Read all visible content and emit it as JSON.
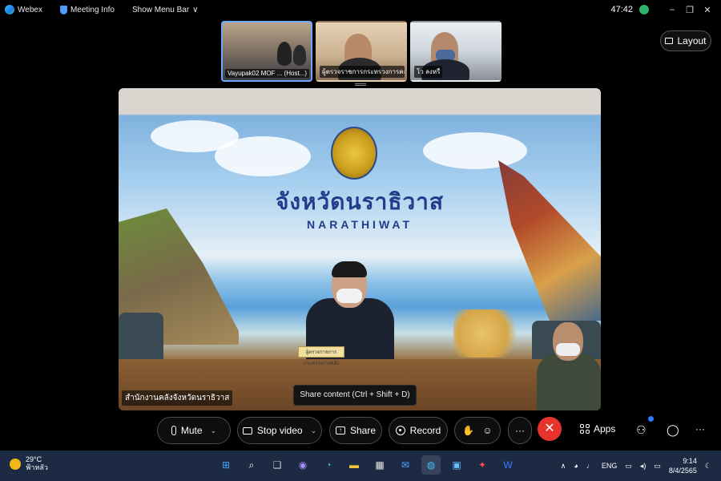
{
  "topbar": {
    "app_name": "Webex",
    "meeting_info": "Meeting Info",
    "show_menu_bar": "Show Menu Bar",
    "chevron": "∨",
    "timer": "47:42",
    "minimize": "–",
    "restore": "❐",
    "close": "✕"
  },
  "thumbnails": [
    {
      "label": "Vayupak02 MOF ... (Host...)"
    },
    {
      "label": "ผู้ตรวจราชการกระทรวงการคลัง"
    },
    {
      "label": "โว ลงหรื"
    }
  ],
  "layout_button": {
    "label": "Layout"
  },
  "main_video": {
    "title_th": "จังหวัดนราธิวาส",
    "title_en": "NARATHIWAT",
    "caption": "สำนักงานคลังจังหวัดนราธิวาส",
    "nameplate": "ผู้ตรวจราชการกระทรวงการคลัง"
  },
  "tooltip": "Share content (Ctrl + Shift + D)",
  "controls": {
    "mute": "Mute",
    "stop_video": "Stop video",
    "share": "Share",
    "record": "Record",
    "more": "···",
    "end_call": "✕",
    "apps": "Apps",
    "dropdown": "⌄"
  },
  "taskbar": {
    "temperature": "29°C",
    "weather_desc": "ฟ้าหลัว",
    "language": "ENG",
    "time": "9:14",
    "date": "8/4/2565"
  }
}
